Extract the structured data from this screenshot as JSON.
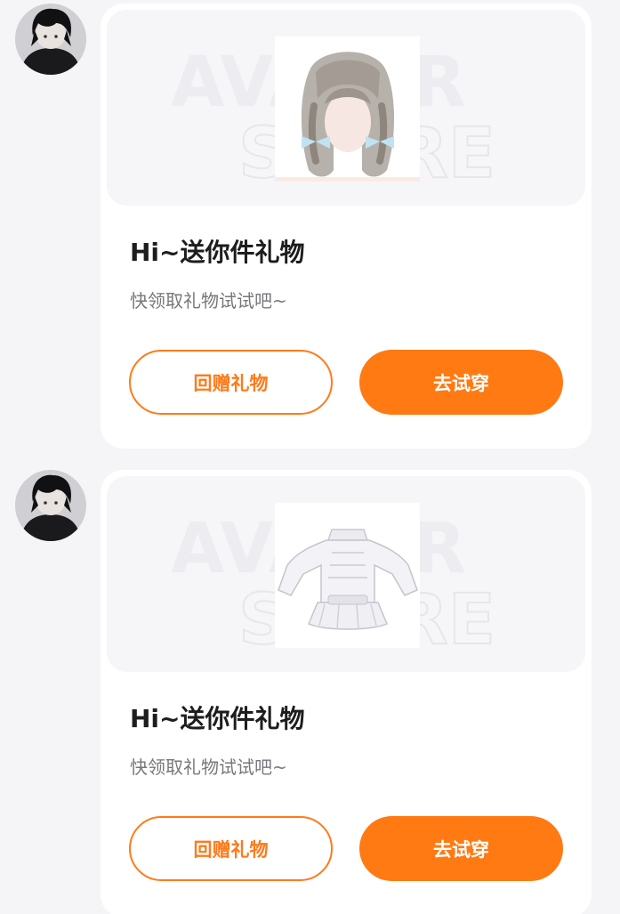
{
  "messages": [
    {
      "avatar_icon": "user-avatar",
      "item_icon": "hairstyle-item",
      "watermark_text": [
        "AVATAR",
        "STORE"
      ],
      "title": "Hi~送你件礼物",
      "subtitle": "快领取礼物试试吧~",
      "return_gift_label": "回赠礼物",
      "try_on_label": "去试穿"
    },
    {
      "avatar_icon": "user-avatar",
      "item_icon": "top-outfit-item",
      "watermark_text": [
        "AVATAR",
        "STORE"
      ],
      "title": "Hi~送你件礼物",
      "subtitle": "快领取礼物试试吧~",
      "return_gift_label": "回赠礼物",
      "try_on_label": "去试穿"
    }
  ],
  "colors": {
    "accent": "#ff7a12",
    "page_background": "#f5f5f7",
    "card_background": "#ffffff",
    "title_text": "#1d1d1f",
    "subtitle_text": "#77777c"
  }
}
